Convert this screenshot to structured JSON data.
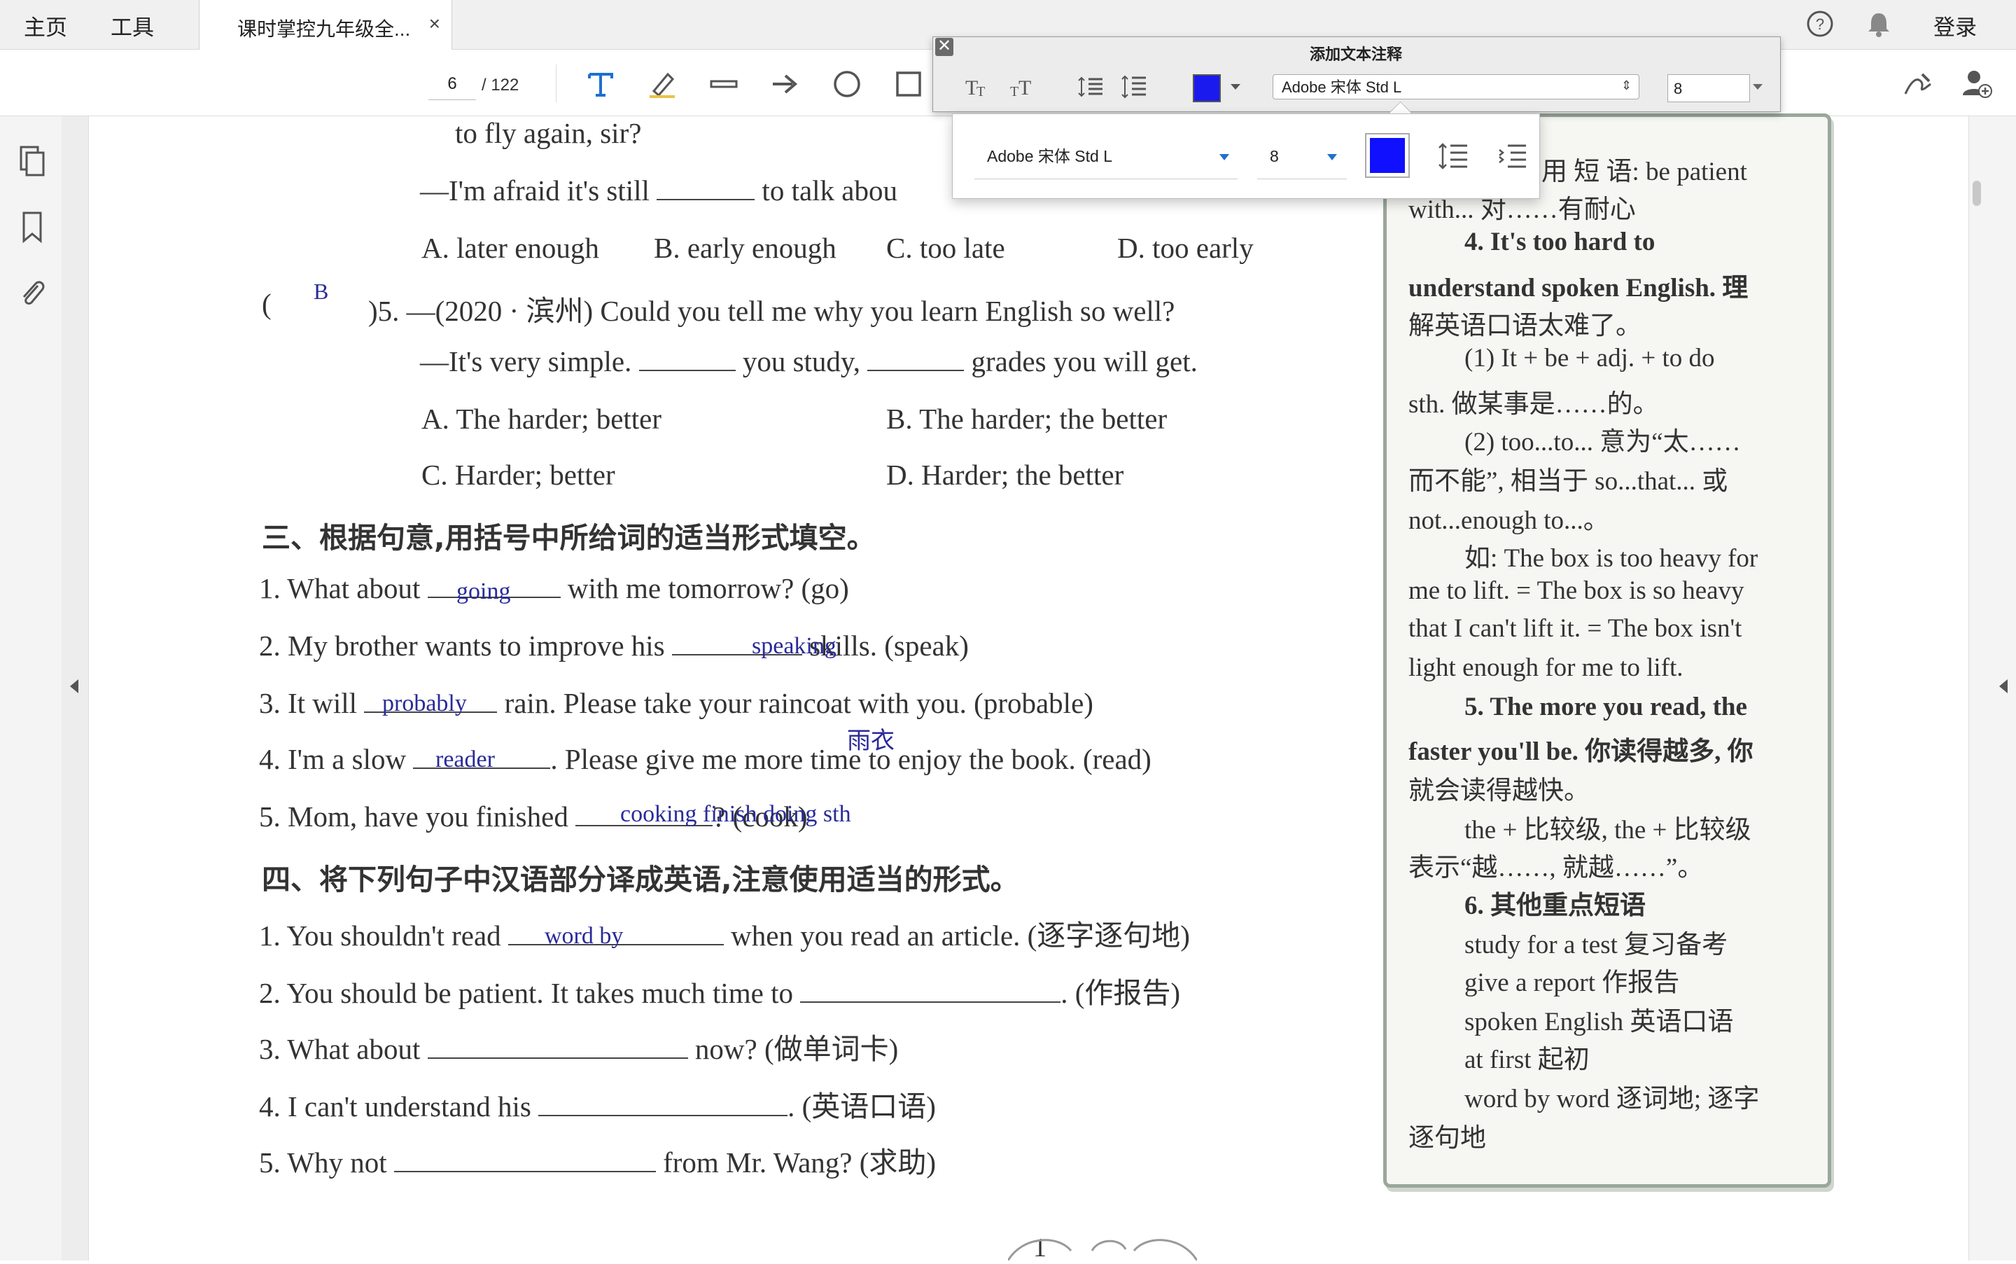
{
  "tabs": {
    "home": "主页",
    "tools": "工具",
    "doc_title": "课时掌控九年级全...",
    "close": "×"
  },
  "header_right": {
    "help_icon": "help-icon",
    "bell_icon": "bell-icon",
    "login": "登录"
  },
  "page_nav": {
    "current": "6",
    "total": "/ 122"
  },
  "annotation_toolbar": {
    "title": "添加文本注释",
    "font": "Adobe 宋体 Std L",
    "size": "8",
    "color": "#1a1aef"
  },
  "popover": {
    "font": "Adobe 宋体 Std L",
    "size": "8",
    "color": "#1010ff"
  },
  "document": {
    "lines": [
      "to fly again, sir?",
      "—I'm afraid it's still",
      "to talk abou",
      "A. later enough",
      "B. early enough",
      "C. too late",
      "D. too early",
      "(",
      ")5. —(2020 · 滨州) Could you tell me why you learn English so well?",
      "—It's very simple.",
      "you study,",
      "grades you will get.",
      "A. The harder; better",
      "B. The harder; the better",
      "C. Harder; better",
      "D. Harder; the better"
    ],
    "section3_title": "三、根据句意,用括号中所给词的适当形式填空。",
    "section3": [
      {
        "pre": "1. What about",
        "post": "with me tomorrow? (go)"
      },
      {
        "pre": "2. My brother wants to improve his",
        "post": "skills. (speak)"
      },
      {
        "pre": "3. It will",
        "post": "rain. Please take your raincoat with you. (probable)"
      },
      {
        "pre": "4. I'm a slow",
        "post": ". Please give me more time to enjoy the book. (read)"
      },
      {
        "pre": "5. Mom, have you finished",
        "post": "? (cook)"
      }
    ],
    "section4_title": "四、将下列句子中汉语部分译成英语,注意使用适当的形式。",
    "section4": [
      {
        "pre": "1. You shouldn't read",
        "post": "when you read an article. (逐字逐句地)"
      },
      {
        "pre": "2. You should be patient. It takes much time to",
        "post": ". (作报告)"
      },
      {
        "pre": "3. What about",
        "post": "now? (做单词卡)"
      },
      {
        "pre": "4. I can't understand his",
        "post": ". (英语口语)"
      },
      {
        "pre": "5. Why not",
        "post": "from Mr. Wang? (求助)"
      }
    ],
    "handwritten": {
      "q5_answer": "B",
      "going": "going",
      "speaking": "speaking",
      "probably": "probably",
      "raincoat_note": "雨衣",
      "reader": "reader",
      "cooking": "cooking finish doing sth",
      "word_by": "word by"
    },
    "page_number": "1"
  },
  "notes": {
    "lines": [
      "用 短 语: be  patient",
      "with... 对……有耐心",
      "4. It's   too   hard   to",
      "understand spoken English. 理",
      "解英语口语太难了。",
      "(1) It + be + adj.  + to do",
      "sth. 做某事是……的。",
      "(2) too...to... 意为“太……",
      "而不能”, 相当于 so...that... 或",
      "not...enough to...。",
      "如: The box is too heavy for",
      "me to lift. = The box is so heavy",
      "that I can't lift it. = The box isn't",
      "light enough for me to lift.",
      "5. The more you read, the",
      "faster you'll be. 你读得越多, 你",
      "就会读得越快。",
      "the + 比较级, the + 比较级",
      "表示“越……, 就越……”。",
      "6. 其他重点短语",
      "study for a test 复习备考",
      "give a report 作报告",
      "spoken English 英语口语",
      "at first 起初",
      "word by word 逐词地; 逐字",
      "逐句地"
    ]
  }
}
